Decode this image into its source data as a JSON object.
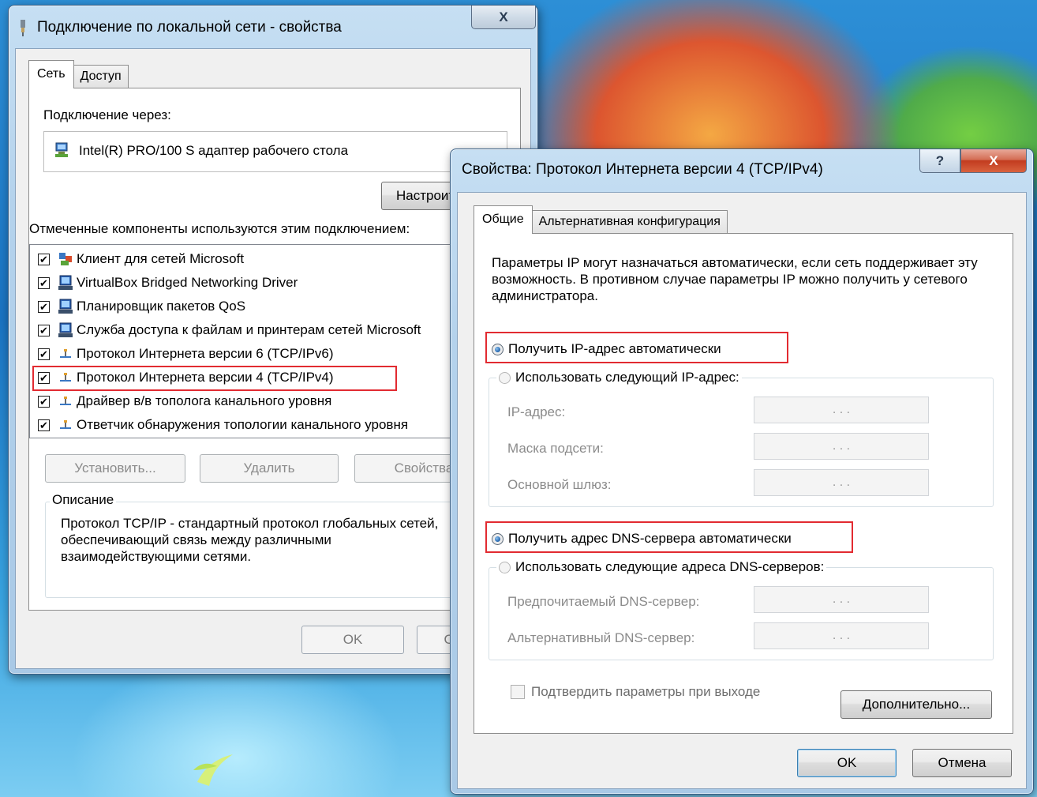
{
  "colors": {
    "highlight": "#e22b31",
    "window_frame": "#b4d2ec",
    "disabled_text": "#8b8b8b"
  },
  "lan_window": {
    "title": "Подключение по локальной сети - свойства",
    "close_glyph": "X",
    "tabs": [
      {
        "label": "Сеть",
        "active": true
      },
      {
        "label": "Доступ",
        "active": false
      }
    ],
    "connect_via_label": "Подключение через:",
    "adapter_name": "Intel(R) PRO/100 S адаптер рабочего стола",
    "configure_button": "Настроить",
    "components_label": "Отмеченные компоненты используются этим подключением:",
    "components": [
      {
        "label": "Клиент для сетей Microsoft",
        "checked": true,
        "icon": "network-client-icon"
      },
      {
        "label": "VirtualBox Bridged Networking Driver",
        "checked": true,
        "icon": "computer-icon"
      },
      {
        "label": "Планировщик пакетов QoS",
        "checked": true,
        "icon": "computer-icon"
      },
      {
        "label": "Служба доступа к файлам и принтерам сетей Microsoft",
        "checked": true,
        "icon": "computer-icon"
      },
      {
        "label": "Протокол Интернета версии 6 (TCP/IPv6)",
        "checked": true,
        "icon": "protocol-icon"
      },
      {
        "label": "Протокол Интернета версии 4 (TCP/IPv4)",
        "checked": true,
        "icon": "protocol-icon"
      },
      {
        "label": "Драйвер в/в тополога канального уровня",
        "checked": true,
        "icon": "protocol-icon"
      },
      {
        "label": "Ответчик обнаружения топологии канального уровня",
        "checked": true,
        "icon": "protocol-icon"
      }
    ],
    "install_button": "Установить...",
    "remove_button": "Удалить",
    "properties_button": "Свойства",
    "description_title": "Описание",
    "description_text": "Протокол TCP/IP - стандартный протокол глобальных сетей, обеспечивающий связь между различными взаимодействующими сетями.",
    "ok_button": "OK",
    "cancel_button": "Отмена"
  },
  "ipv4_window": {
    "title": "Свойства: Протокол Интернета версии 4 (TCP/IPv4)",
    "help_glyph": "?",
    "close_glyph": "X",
    "tabs": [
      {
        "label": "Общие",
        "active": true
      },
      {
        "label": "Альтернативная конфигурация",
        "active": false
      }
    ],
    "intro_text": "Параметры IP могут назначаться автоматически, если сеть поддерживает эту возможность. В противном случае параметры IP можно получить у сетевого администратора.",
    "ip_auto_radio": "Получить IP-адрес автоматически",
    "ip_auto_selected": true,
    "ip_manual_radio": "Использовать следующий IP-адрес:",
    "ip_address_label": "IP-адрес:",
    "subnet_mask_label": "Маска подсети:",
    "gateway_label": "Основной шлюз:",
    "ip_placeholder_dots": ". . .",
    "dns_auto_radio": "Получить адрес DNS-сервера автоматически",
    "dns_auto_selected": true,
    "dns_manual_radio": "Использовать следующие адреса DNS-серверов:",
    "preferred_dns_label": "Предпочитаемый DNS-сервер:",
    "alternate_dns_label": "Альтернативный DNS-сервер:",
    "validate_checkbox": "Подтвердить параметры при выходе",
    "validate_checked": false,
    "advanced_button": "Дополнительно...",
    "ok_button": "OK",
    "cancel_button": "Отмена"
  }
}
